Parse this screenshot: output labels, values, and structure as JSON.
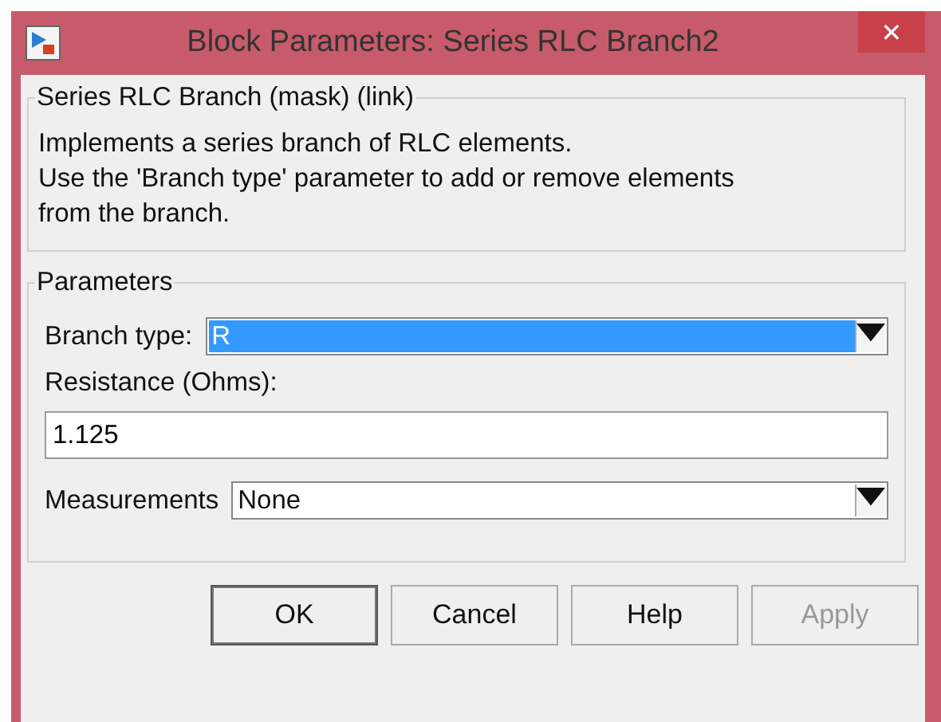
{
  "window": {
    "title": "Block Parameters: Series RLC Branch2",
    "close": "✕"
  },
  "description": {
    "title": "Series RLC Branch (mask) (link)",
    "text": "Implements a series branch of RLC elements.\nUse the 'Branch type' parameter to add or remove elements\nfrom the branch."
  },
  "parameters": {
    "title": "Parameters",
    "fields": [
      {
        "kind": "dropdown",
        "label": "Branch type:",
        "value": "R",
        "selected": true
      },
      {
        "kind": "text",
        "label": "Resistance (Ohms):",
        "value": "1.125"
      },
      {
        "kind": "dropdown",
        "label": "Measurements",
        "value": "None",
        "selected": false
      }
    ]
  },
  "buttons": [
    {
      "label": "OK",
      "disabled": false,
      "default": true
    },
    {
      "label": "Cancel",
      "disabled": false,
      "default": false
    },
    {
      "label": "Help",
      "disabled": false,
      "default": false
    },
    {
      "label": "Apply",
      "disabled": true,
      "default": false
    }
  ]
}
